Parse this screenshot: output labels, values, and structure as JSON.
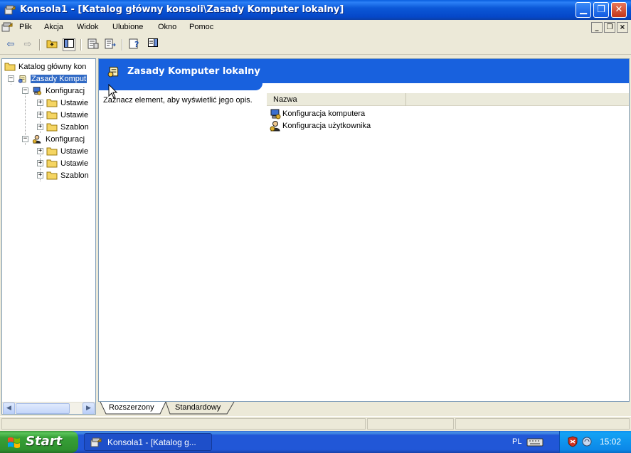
{
  "window": {
    "title": "Konsola1 - [Katalog główny konsoli\\Zasady Komputer lokalny]",
    "minimize_glyph": "▁",
    "maximize_glyph": "❐",
    "close_glyph": "✕"
  },
  "menu": {
    "items": [
      "Plik",
      "Akcja",
      "Widok",
      "Ulubione",
      "Okno",
      "Pomoc"
    ],
    "mdi_minimize": "_",
    "mdi_restore": "❐",
    "mdi_close": "×"
  },
  "toolbar": {
    "back": "⇦",
    "forward": "⇨",
    "up": "⬑",
    "show_tree": "▥",
    "properties": "☷",
    "export": "⇲",
    "help": "?",
    "action_pane": "▤"
  },
  "tree": {
    "items": [
      {
        "label": "Katalog główny kon",
        "level": 0
      },
      {
        "label": "Zasady Komput",
        "level": 1,
        "expander": "−",
        "selected": true
      },
      {
        "label": "Konfiguracj",
        "level": 2,
        "expander": "−"
      },
      {
        "label": "Ustawie",
        "level": 3,
        "expander": "+"
      },
      {
        "label": "Ustawie",
        "level": 3,
        "expander": "+"
      },
      {
        "label": "Szablon",
        "level": 3,
        "expander": "+"
      },
      {
        "label": "Konfiguracj",
        "level": 2,
        "expander": "−"
      },
      {
        "label": "Ustawie",
        "level": 3,
        "expander": "+"
      },
      {
        "label": "Ustawie",
        "level": 3,
        "expander": "+"
      },
      {
        "label": "Szablon",
        "level": 3,
        "expander": "+"
      }
    ],
    "scroll_left": "◀",
    "scroll_right": "▶"
  },
  "details": {
    "header_title": "Zasady Komputer lokalny",
    "description": "Zaznacz element, aby wyświetlić jego opis.",
    "column_name": "Nazwa",
    "rows": [
      "Konfiguracja komputera",
      "Konfiguracja użytkownika"
    ]
  },
  "tabs": [
    "Rozszerzony",
    "Standardowy"
  ],
  "taskbar": {
    "start_label": "Start",
    "task_label": "Konsola1 - [Katalog g...",
    "language": "PL",
    "clock": "15:02"
  },
  "colors": {
    "title_bar": "#0b58d8",
    "header_blue": "#1861de",
    "selection": "#316ac5",
    "start_green": "#37a037",
    "tray_blue": "#0c88e8"
  }
}
